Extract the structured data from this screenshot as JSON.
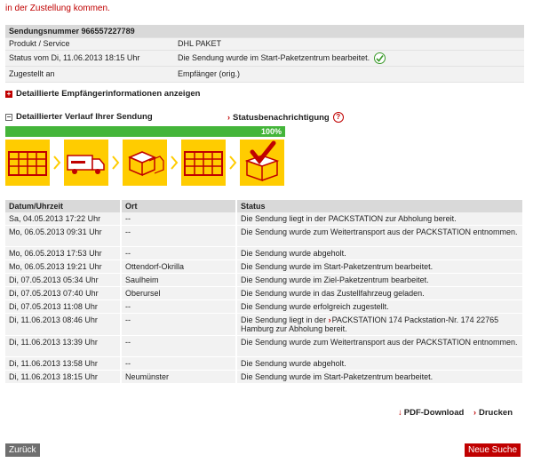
{
  "top_note": "in der Zustellung kommen.",
  "summary": {
    "header": "Sendungsnummer 966557227789",
    "rows": [
      {
        "label": "Produkt / Service",
        "value": "DHL PAKET"
      },
      {
        "label": "Status vom Di, 11.06.2013 18:15 Uhr",
        "value": "Die Sendung wurde im Start-Paketzentrum bearbeitet."
      },
      {
        "label": "Zugestellt an",
        "value": "Empfänger (orig.)"
      }
    ]
  },
  "toggles": {
    "recipient_info": "Detaillierte Empfängerinformationen anzeigen",
    "history": "Detaillierter Verlauf Ihrer Sendung",
    "status_notification": "Statusbenachrichtigung",
    "help_glyph": "?",
    "plus_glyph": "+",
    "minus_glyph": "−",
    "chevron_glyph": "›"
  },
  "progress": {
    "percent": 100,
    "label": "100%"
  },
  "history": {
    "headers": [
      "Datum/Uhrzeit",
      "Ort",
      "Status"
    ],
    "rows": [
      {
        "date": "Sa, 04.05.2013 17:22 Uhr",
        "place": "--",
        "status": "Die Sendung liegt in der PACKSTATION zur Abholung bereit."
      },
      {
        "date": "Mo, 06.05.2013 09:31 Uhr",
        "place": "--",
        "status": "Die Sendung wurde zum Weitertransport aus der PACKSTATION entnommen."
      },
      {
        "date": "Mo, 06.05.2013 17:53 Uhr",
        "place": "--",
        "status": "Die Sendung wurde abgeholt."
      },
      {
        "date": "Mo, 06.05.2013 19:21 Uhr",
        "place": "Ottendorf-Okrilla",
        "status": "Die Sendung wurde im Start-Paketzentrum bearbeitet."
      },
      {
        "date": "Di, 07.05.2013 05:34 Uhr",
        "place": "Saulheim",
        "status": "Die Sendung wurde im Ziel-Paketzentrum bearbeitet."
      },
      {
        "date": "Di, 07.05.2013 07:40 Uhr",
        "place": "Oberursel",
        "status": "Die Sendung wurde in das Zustellfahrzeug geladen."
      },
      {
        "date": "Di, 07.05.2013 11:08 Uhr",
        "place": "--",
        "status": "Die Sendung wurde erfolgreich zugestellt."
      },
      {
        "date": "Di, 11.06.2013 08:46 Uhr",
        "place": "--",
        "status_pre": "Die Sendung liegt in der",
        "status_link": "PACKSTATION 174 Packstation-Nr. 174 22765 Hamburg",
        "status_post": "zur Abholung bereit."
      },
      {
        "date": "Di, 11.06.2013 13:39 Uhr",
        "place": "--",
        "status": "Die Sendung wurde zum Weitertransport aus der PACKSTATION entnommen."
      },
      {
        "date": "Di, 11.06.2013 13:58 Uhr",
        "place": "--",
        "status": "Die Sendung wurde abgeholt."
      },
      {
        "date": "Di, 11.06.2013 18:15 Uhr",
        "place": "Neumünster",
        "status": "Die Sendung wurde im Start-Paketzentrum bearbeitet."
      }
    ]
  },
  "actions": {
    "pdf": "PDF-Download",
    "pdf_glyph": "↓",
    "print": "Drucken",
    "back": "Zurück",
    "new_search": "Neue Suche"
  },
  "colors": {
    "brand_red": "#c00000",
    "dhl_yellow": "#ffcc00",
    "progress_green": "#44b53a"
  }
}
